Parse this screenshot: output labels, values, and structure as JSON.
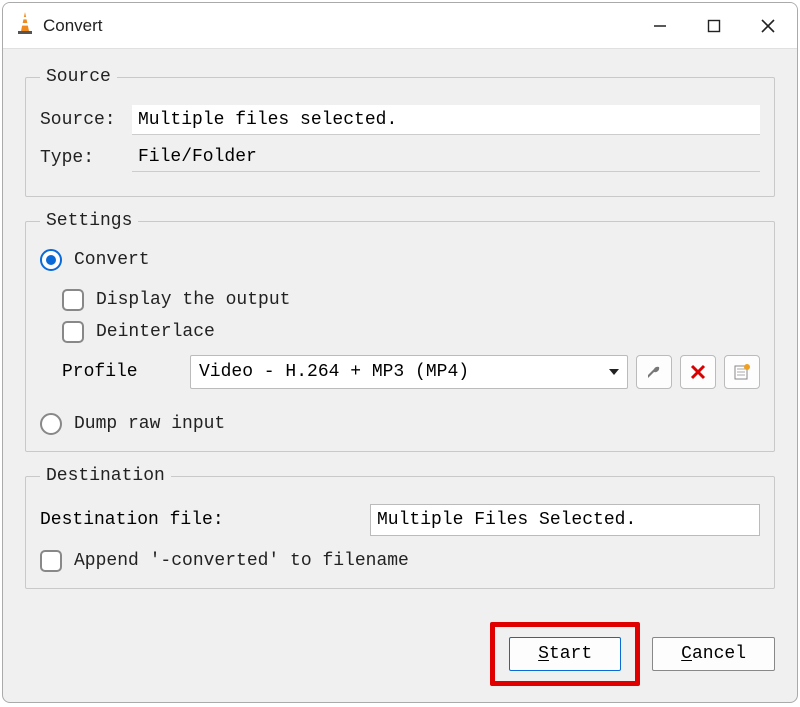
{
  "window": {
    "title": "Convert"
  },
  "source": {
    "legend": "Source",
    "source_label": "Source:",
    "source_value": "Multiple files selected.",
    "type_label": "Type:",
    "type_value": "File/Folder"
  },
  "settings": {
    "legend": "Settings",
    "convert_label": "Convert",
    "display_output_label": "Display the output",
    "deinterlace_label": "Deinterlace",
    "profile_label": "Profile",
    "profile_selected": "Video - H.264 + MP3 (MP4)",
    "dump_raw_label": "Dump raw input"
  },
  "destination": {
    "legend": "Destination",
    "dest_file_label": "Destination file:",
    "dest_file_value": "Multiple Files Selected.",
    "append_label": "Append '-converted' to filename"
  },
  "footer": {
    "start_label": "Start",
    "cancel_label": "Cancel"
  },
  "icons": {
    "wrench": "wrench-icon",
    "delete": "delete-icon",
    "new_profile": "new-profile-icon"
  }
}
